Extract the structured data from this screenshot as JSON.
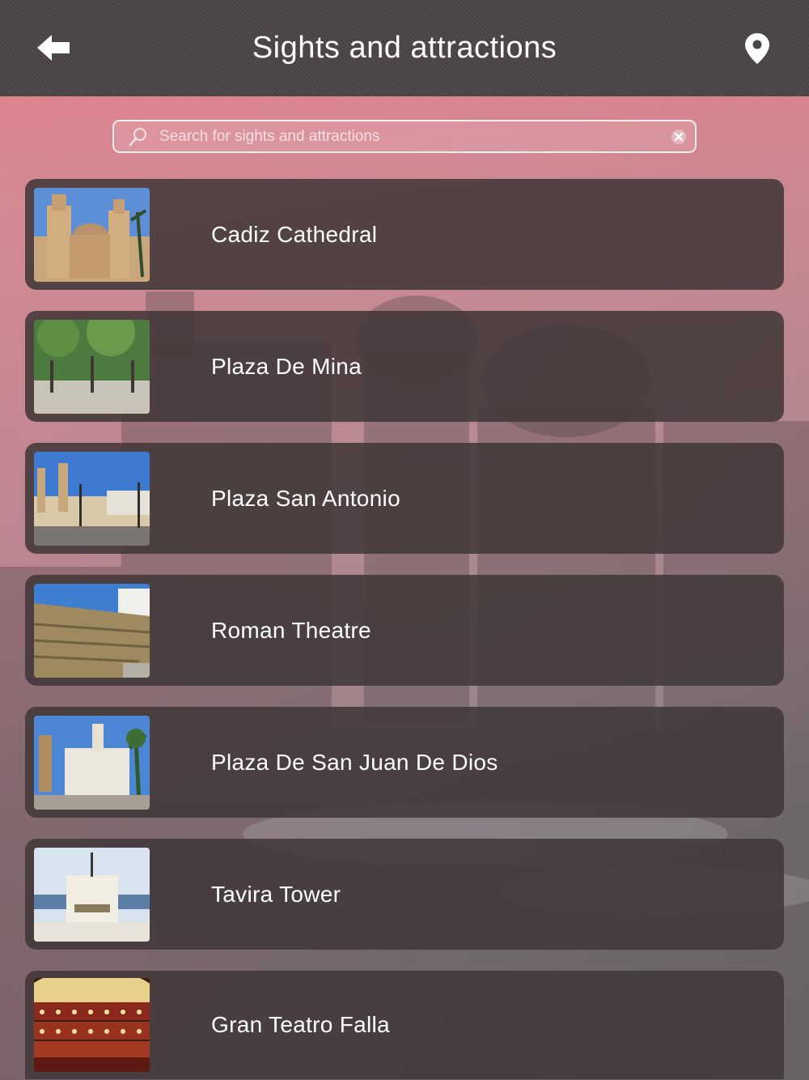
{
  "header": {
    "title": "Sights and attractions",
    "back_icon": "back-arrow-icon",
    "map_icon": "map-pin-icon"
  },
  "search": {
    "placeholder": "Search for sights and attractions",
    "value": ""
  },
  "colors": {
    "header_bg": "#4a4444",
    "item_bg": "#423839",
    "accent_pink": "#e8808c",
    "text": "#ffffff"
  },
  "items": [
    {
      "label": "Cadiz Cathedral"
    },
    {
      "label": "Plaza De Mina"
    },
    {
      "label": "Plaza San Antonio"
    },
    {
      "label": "Roman Theatre"
    },
    {
      "label": "Plaza De San Juan De Dios"
    },
    {
      "label": "Tavira Tower"
    },
    {
      "label": "Gran Teatro Falla"
    }
  ]
}
